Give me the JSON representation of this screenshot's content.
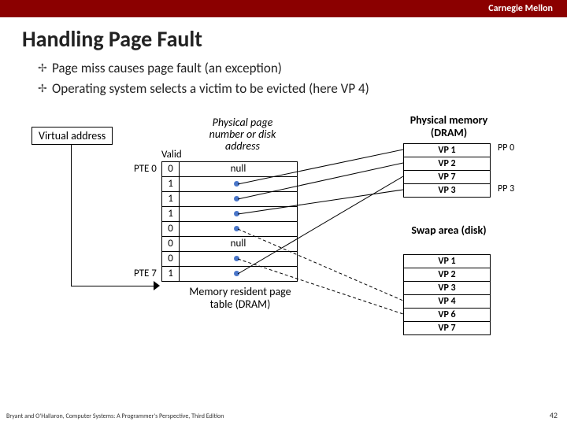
{
  "university": "Carnegie Mellon",
  "title": "Handling Page Fault",
  "bullets": [
    "Page miss causes page fault (an exception)",
    "Operating system selects a victim to be evicted (here VP 4)"
  ],
  "va_label": "Virtual address",
  "pt": {
    "header": "Physical page number or disk address",
    "valid_label": "Valid",
    "left_label_0": "PTE 0",
    "left_label_7": "PTE 7",
    "rows": [
      {
        "valid": "0",
        "addr": "null",
        "has_dot": false
      },
      {
        "valid": "1",
        "addr": "",
        "has_dot": true
      },
      {
        "valid": "1",
        "addr": "",
        "has_dot": true
      },
      {
        "valid": "1",
        "addr": "",
        "has_dot": true
      },
      {
        "valid": "0",
        "addr": "",
        "has_dot": true
      },
      {
        "valid": "0",
        "addr": "null",
        "has_dot": false
      },
      {
        "valid": "0",
        "addr": "",
        "has_dot": true
      },
      {
        "valid": "1",
        "addr": "",
        "has_dot": true
      }
    ],
    "caption": "Memory resident page table (DRAM)"
  },
  "pm": {
    "header": "Physical memory (DRAM)",
    "rows": [
      "VP 1",
      "VP 2",
      "VP 7",
      "VP 3"
    ],
    "pp_labels": [
      "PP 0",
      "PP 3"
    ]
  },
  "swap": {
    "header": "Swap area (disk)",
    "rows": [
      "VP 1",
      "VP 2",
      "VP 3",
      "VP 4",
      "VP 6",
      "VP 7"
    ]
  },
  "footer_left": "Bryant and O'Hallaron, Computer Systems: A Programmer's Perspective, Third Edition",
  "footer_right": "42"
}
